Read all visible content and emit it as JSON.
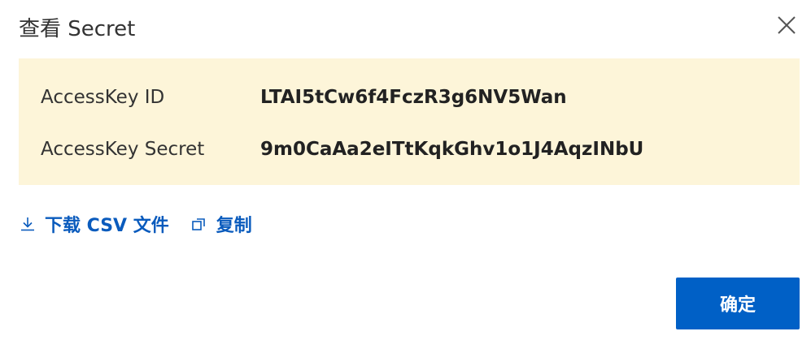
{
  "dialog": {
    "title": "查看 Secret",
    "close_icon": "close-icon"
  },
  "credentials": {
    "rows": [
      {
        "label": "AccessKey ID",
        "value": "LTAI5tCw6f4FczR3g6NV5Wan"
      },
      {
        "label": "AccessKey Secret",
        "value": "9m0CaAa2eITtKqkGhv1o1J4AqzINbU"
      }
    ],
    "panel_color": "#fdf5d9"
  },
  "actions": {
    "download": {
      "label": "下载 CSV 文件",
      "icon": "download-icon"
    },
    "copy": {
      "label": "复制",
      "icon": "copy-icon"
    },
    "link_color": "#0a5bbd"
  },
  "footer": {
    "confirm_label": "确定",
    "confirm_color": "#0060c6"
  }
}
